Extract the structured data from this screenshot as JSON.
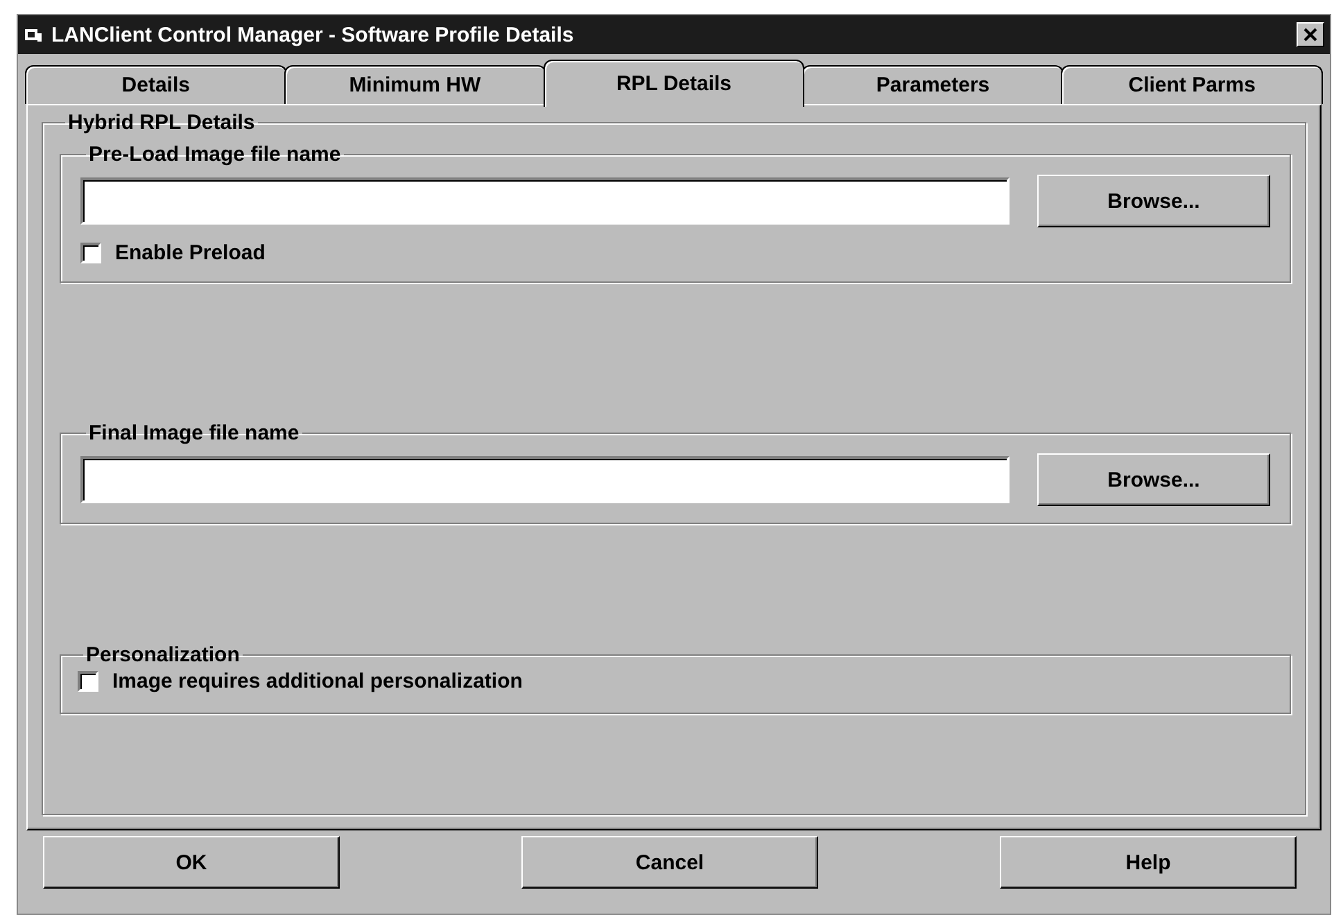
{
  "window": {
    "title": "LANClient Control Manager - Software Profile Details"
  },
  "tabs": [
    {
      "label": "Details",
      "selected": false
    },
    {
      "label": "Minimum HW",
      "selected": false
    },
    {
      "label": "RPL Details",
      "selected": true
    },
    {
      "label": "Parameters",
      "selected": false
    },
    {
      "label": "Client Parms",
      "selected": false
    }
  ],
  "group": {
    "title": "Hybrid RPL Details",
    "sections": [
      {
        "kind": "file",
        "title": "Pre-Load Image file name",
        "browse": "Browse...",
        "checkbox": {
          "label": "Enable Preload",
          "checked": false
        }
      },
      {
        "kind": "file",
        "title": "Final Image file name",
        "browse": "Browse..."
      },
      {
        "kind": "options",
        "title": "Personalization",
        "checkbox": {
          "label": "Image requires additional personalization",
          "checked": false
        }
      }
    ]
  },
  "buttons": [
    "OK",
    "Cancel",
    "Help"
  ]
}
